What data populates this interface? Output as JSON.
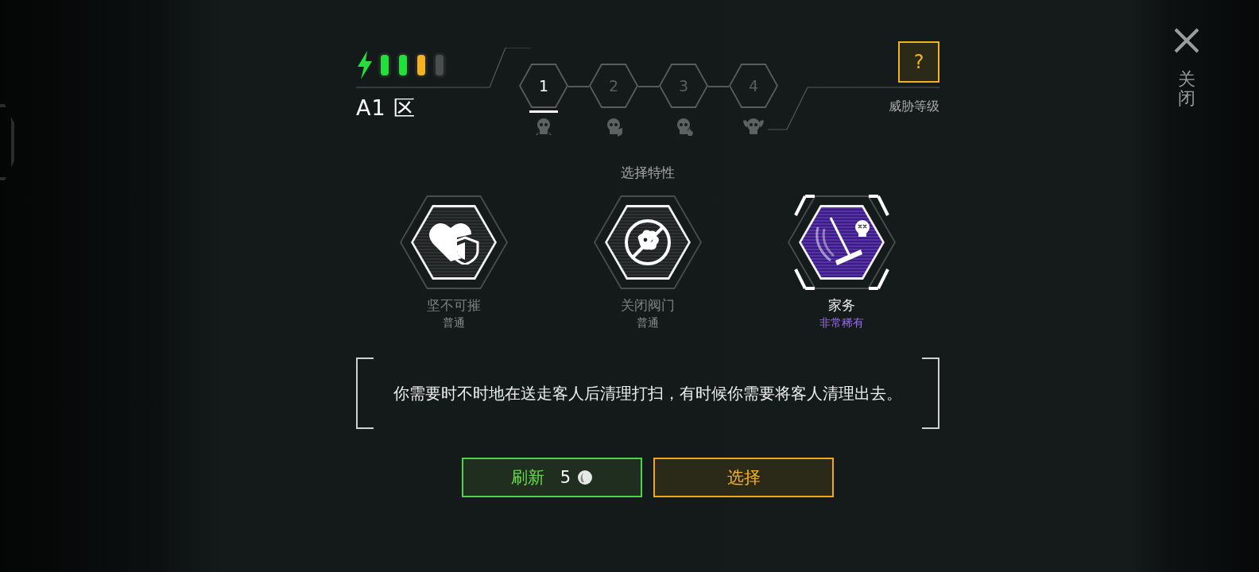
{
  "energy": {
    "pips": [
      {
        "color": "#22e03a"
      },
      {
        "color": "#22e03a"
      },
      {
        "color": "#f5b21c"
      },
      {
        "color": "#4a4e4e"
      }
    ]
  },
  "zone": "A1 区",
  "threat_levels": [
    {
      "label": "1",
      "selected": true
    },
    {
      "label": "2",
      "selected": false
    },
    {
      "label": "3",
      "selected": false
    },
    {
      "label": "4",
      "selected": false
    }
  ],
  "help_button": "?",
  "threat_label": "威胁等级",
  "close": {
    "label": "关闭"
  },
  "section_title": "选择特性",
  "traits": [
    {
      "kind": "defense",
      "name": "坚不可摧",
      "rarity": "普通",
      "color": "#8a8d8d",
      "selected": false
    },
    {
      "kind": "gas",
      "name": "关闭阀门",
      "rarity": "普通",
      "color": "#8a8d8d",
      "selected": false
    },
    {
      "kind": "cleaning",
      "name": "家务",
      "rarity": "非常稀有",
      "color": "#9b6fe0",
      "selected": true
    }
  ],
  "description": "你需要时不时地在送走客人后清理打扫，有时候你需要将客人清理出去。",
  "buttons": [
    {
      "kind": "refresh",
      "label": "刷新",
      "cost": "5"
    },
    {
      "kind": "select",
      "label": "选择"
    }
  ]
}
